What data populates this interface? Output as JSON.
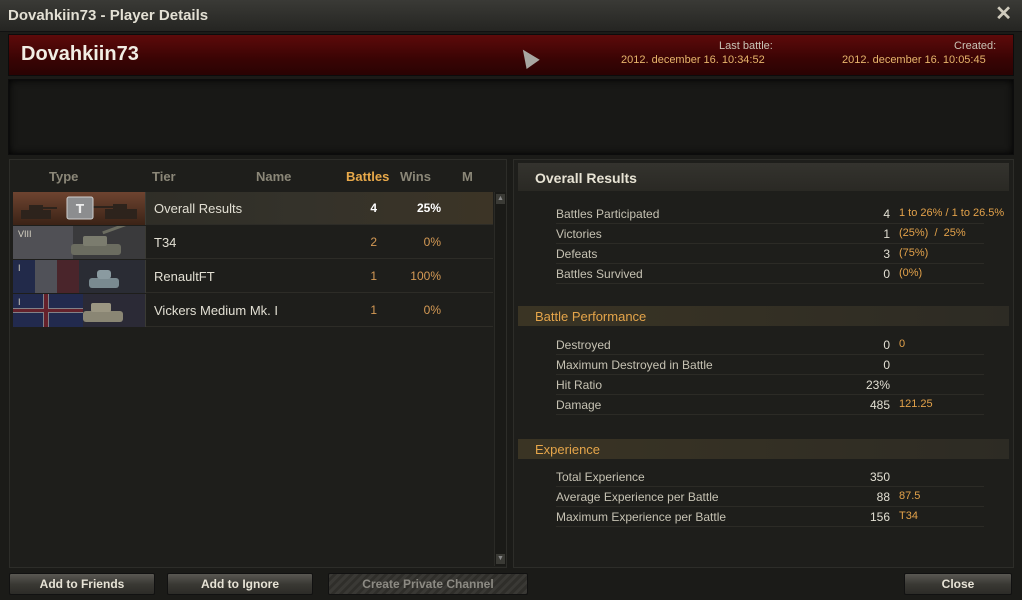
{
  "window": {
    "title": "Dovahkiin73 - Player Details",
    "close_glyph": "✕"
  },
  "header": {
    "player_name": "Dovahkiin73",
    "last_battle_label": "Last battle:",
    "last_battle_value": "2012. december 16. 10:34:52",
    "created_label": "Created:",
    "created_value": "2012. december 16. 10:05:45"
  },
  "vehicle_table": {
    "columns": [
      "Type",
      "Tier",
      "Name",
      "Battles",
      "Wins",
      "M"
    ],
    "active_column": "Battles",
    "rows": [
      {
        "tier": "",
        "name": "Overall Results",
        "battles": "4",
        "wins": "25%",
        "icon": "tank-group-icon"
      },
      {
        "tier": "VIII",
        "name": "T34",
        "battles": "2",
        "wins": "0%",
        "icon": "heavy-tank-icon"
      },
      {
        "tier": "I",
        "name": "RenaultFT",
        "battles": "1",
        "wins": "100%",
        "icon": "light-tank-icon"
      },
      {
        "tier": "I",
        "name": "Vickers Medium Mk. I",
        "battles": "1",
        "wins": "0%",
        "icon": "medium-tank-icon"
      }
    ]
  },
  "overall": {
    "title": "Overall Results",
    "stats": [
      {
        "label": "Battles Participated",
        "value": "4",
        "extra": "1 to 26% / 1 to 26.5%"
      },
      {
        "label": "Victories",
        "value": "1",
        "extra": "(25%)  /  25%"
      },
      {
        "label": "Defeats",
        "value": "3",
        "extra": "(75%)"
      },
      {
        "label": "Battles Survived",
        "value": "0",
        "extra": "(0%)"
      }
    ]
  },
  "performance": {
    "title": "Battle Performance",
    "stats": [
      {
        "label": "Destroyed",
        "value": "0",
        "extra": "0"
      },
      {
        "label": "Maximum Destroyed in Battle",
        "value": "0",
        "extra": ""
      },
      {
        "label": "Hit Ratio",
        "value": "23%",
        "extra": ""
      },
      {
        "label": "Damage",
        "value": "485",
        "extra": "121.25"
      }
    ]
  },
  "experience": {
    "title": "Experience",
    "stats": [
      {
        "label": "Total Experience",
        "value": "350",
        "extra": ""
      },
      {
        "label": "Average Experience per Battle",
        "value": "88",
        "extra": "87.5"
      },
      {
        "label": "Maximum Experience per Battle",
        "value": "156",
        "extra": "T34"
      }
    ]
  },
  "buttons": {
    "add_friends": "Add to Friends",
    "add_ignore": "Add to Ignore",
    "private_channel": "Create Private Channel",
    "close": "Close"
  },
  "colors": {
    "accent": "#e5a54a",
    "header_red": "#5d0a0a",
    "background": "#1b1b18"
  }
}
